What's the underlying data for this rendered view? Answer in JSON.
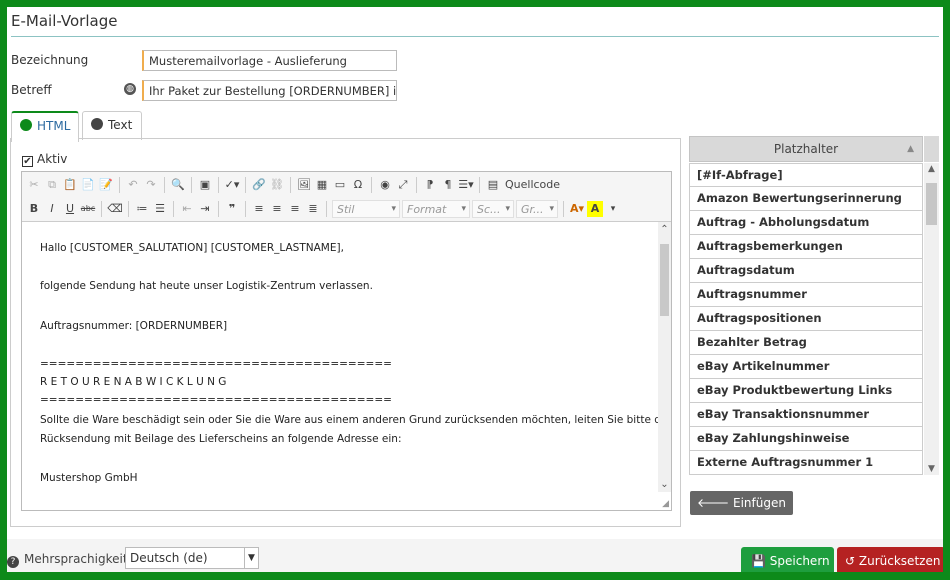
{
  "page": {
    "title": "E-Mail-Vorlage"
  },
  "form": {
    "bezeichnung_label": "Bezeichnung",
    "bezeichnung_value": "Musteremailvorlage - Auslieferung",
    "betreff_label": "Betreff",
    "betreff_value": "Ihr Paket zur Bestellung [ORDERNUMBER] ist u"
  },
  "tabs": [
    {
      "label": "HTML",
      "icon": "globe-icon",
      "active": true
    },
    {
      "label": "Text",
      "icon": "globe-icon",
      "active": false
    }
  ],
  "aktiv": {
    "label": "Aktiv",
    "checked": true,
    "mark": "✔"
  },
  "toolbar": {
    "source_label": "Quellcode",
    "style_placeholder": "Stil",
    "format_placeholder": "Format",
    "size_placeholder": "Sc...",
    "font_placeholder": "Gr..."
  },
  "editor_lines": [
    "Hallo [CUSTOMER_SALUTATION] [CUSTOMER_LASTNAME],",
    "folgende Sendung hat heute unser Logistik-Zentrum verlassen.",
    "Auftragsnummer: [ORDERNUMBER]",
    "========================================",
    "R E T O U R E N A B W I C K L U N G",
    "========================================",
    "Sollte die Ware beschädigt sein oder Sie die Ware aus einem anderen Grund zurücksenden möchten, leiten Sie bitte die",
    "Rücksendung mit Beilage des Lieferscheins an folgende Adresse ein:",
    "Mustershop GmbH"
  ],
  "placeholders": {
    "header": "Platzhalter",
    "items": [
      "[#If-Abfrage]",
      "Amazon Bewertungserinnerung",
      "Auftrag - Abholungsdatum",
      "Auftragsbemerkungen",
      "Auftragsdatum",
      "Auftragsnummer",
      "Auftragspositionen",
      "Bezahlter Betrag",
      "eBay Artikelnummer",
      "eBay Produktbewertung Links",
      "eBay Transaktionsnummer",
      "eBay Zahlungshinweise",
      "Externe Auftragsnummer 1"
    ],
    "insert_label": "Einfügen"
  },
  "footer": {
    "multilang_label": "Mehrsprachigkeit",
    "language_value": "Deutsch (de)",
    "save_label": "Speichern",
    "reset_label": "Zurücksetzen"
  },
  "colors": {
    "frame": "#0d8a1a",
    "save": "#1e9e3e",
    "reset": "#b52222",
    "accent_border": "#f0ad4e"
  }
}
